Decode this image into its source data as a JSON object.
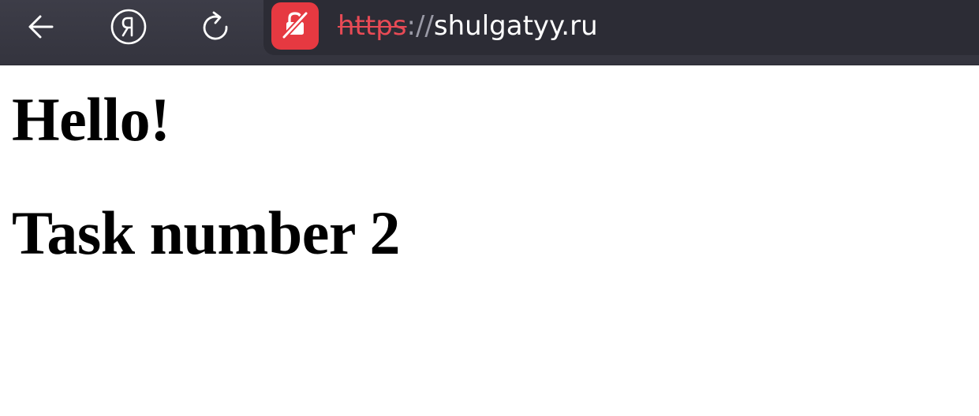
{
  "browser": {
    "icons": {
      "back": "arrow-left-icon",
      "yandex": "yandex-logo-icon",
      "reload": "reload-icon",
      "lock": "insecure-lock-icon"
    },
    "url": {
      "scheme": "https",
      "separator": "://",
      "host": "shulgatyy.ru"
    },
    "colors": {
      "toolbar": "#383842",
      "insecure_badge": "#e63941",
      "scheme_text": "#e84a55"
    }
  },
  "page": {
    "heading1": "Hello!",
    "heading2": "Task number 2"
  }
}
